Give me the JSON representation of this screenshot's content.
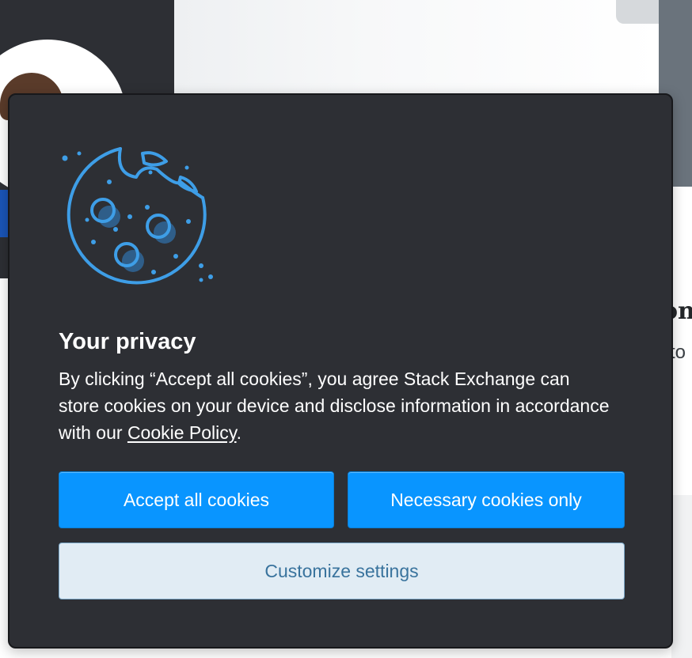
{
  "background": {
    "heading_fragment": "on",
    "text_fragment": "to"
  },
  "cookie_modal": {
    "icon": "cookie-icon",
    "title": "Your privacy",
    "body_text": "By clicking “Accept all cookies”, you agree Stack Exchange can store cookies on your device and disclose information in accordance with our ",
    "policy_link_label": "Cookie Policy",
    "body_end": ".",
    "buttons": {
      "accept_all": "Accept all cookies",
      "necessary_only": "Necessary cookies only",
      "customize": "Customize settings"
    }
  },
  "colors": {
    "modal_background": "#2d2f34",
    "primary_button": "#0995ff",
    "secondary_button": "#e1ecf4",
    "secondary_button_text": "#39739d",
    "cookie_illustration": "#3e9ee7"
  }
}
